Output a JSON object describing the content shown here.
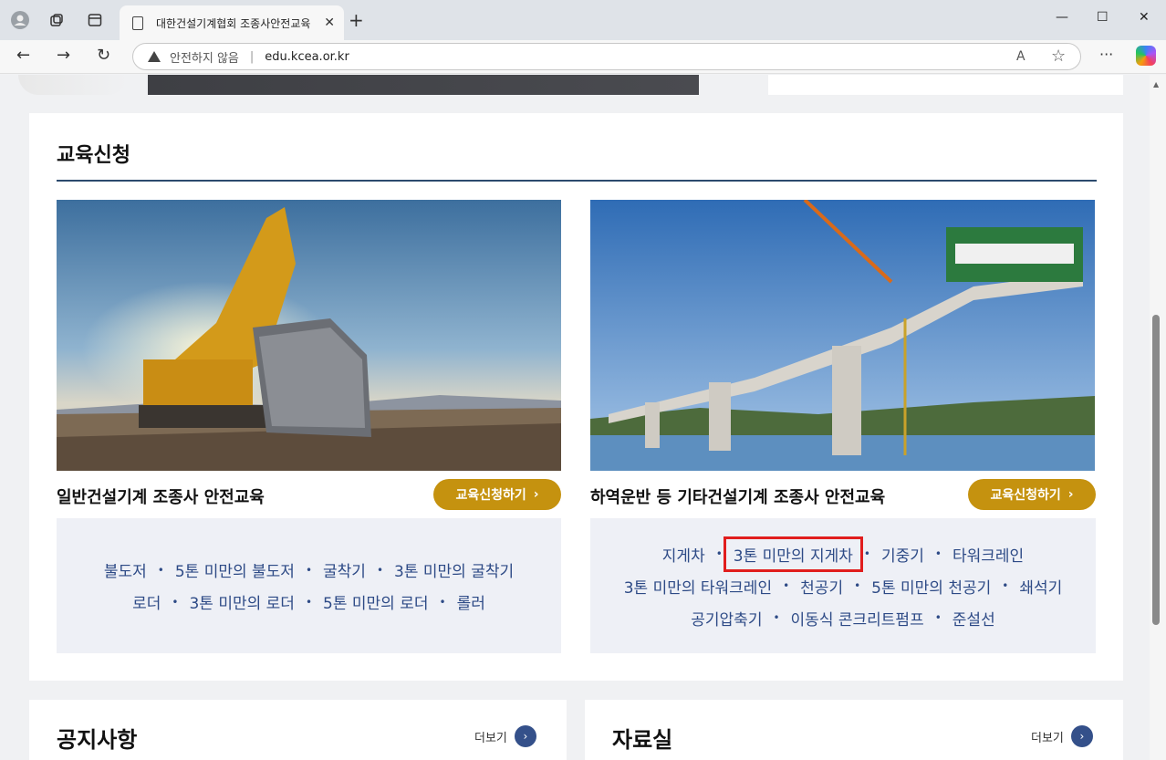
{
  "browser": {
    "tab_title": "대한건설기계협회 조종사안전교육",
    "tab_close": "✕",
    "new_tab": "+",
    "security_label": "안전하지 않음",
    "separator": "|",
    "url": "edu.kcea.or.kr",
    "read_aloud": "A",
    "favorite": "☆",
    "more": "···",
    "minimize": "—",
    "maximize": "☐",
    "close": "✕"
  },
  "section": {
    "title": "교육신청",
    "cards": [
      {
        "title": "일반건설기계 조종사 안전교육",
        "button": "교육신청하기",
        "rows": [
          [
            "불도저",
            "5톤 미만의 불도저",
            "굴착기",
            "3톤 미만의 굴착기"
          ],
          [
            "로더",
            "3톤 미만의 로더",
            "5톤 미만의 로더",
            "롤러"
          ]
        ]
      },
      {
        "title": "하역운반 등 기타건설기계 조종사 안전교육",
        "button": "교육신청하기",
        "rows": [
          [
            "지게차",
            "3톤 미만의 지게차",
            "기중기",
            "타워크레인"
          ],
          [
            "3톤 미만의 타워크레인",
            "천공기",
            "5톤 미만의 천공기",
            "쇄석기"
          ],
          [
            "공기압축기",
            "이동식 콘크리트펌프",
            "준설선"
          ]
        ]
      }
    ]
  },
  "notice": {
    "title": "공지사항",
    "more": "더보기"
  },
  "archive": {
    "title": "자료실",
    "more": "더보기"
  },
  "colors": {
    "accent": "#c5920f",
    "link": "#2d4a86",
    "highlight": "#e11d1d"
  }
}
